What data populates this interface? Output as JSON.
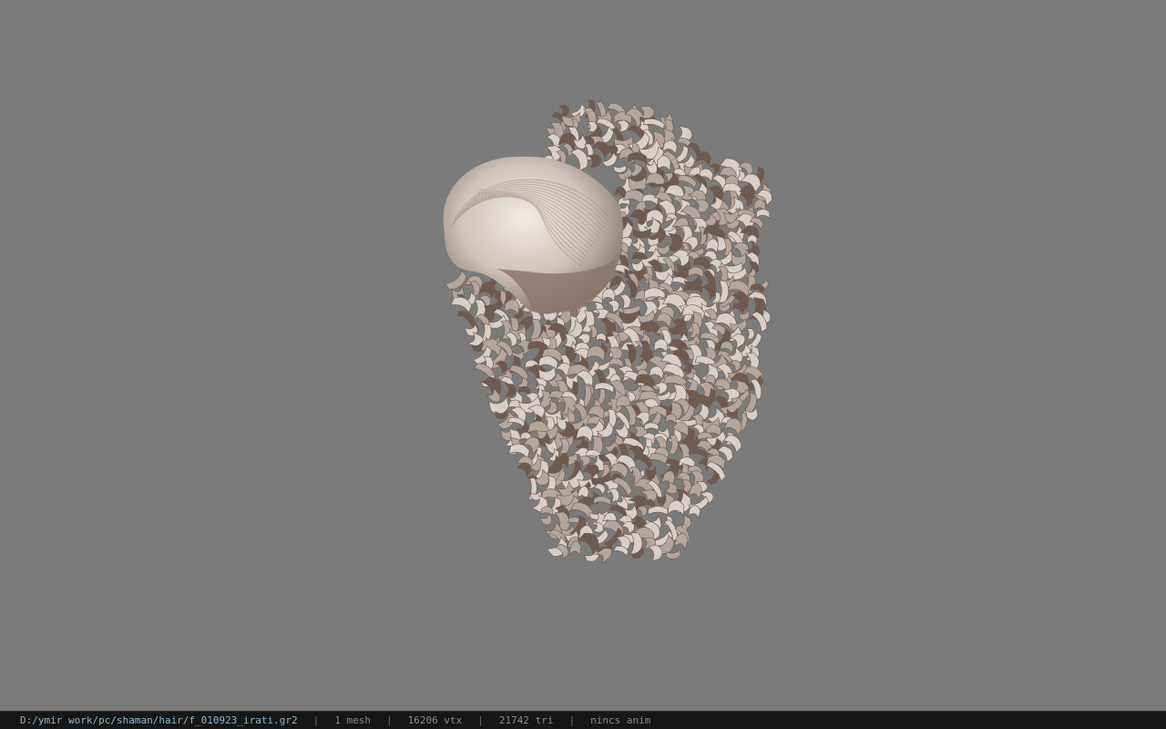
{
  "viewer": {
    "background_color": "#7b7b7b",
    "model_name": "hair mesh",
    "hair_light": "#d9cfc8",
    "hair_mid": "#b4a69c",
    "hair_dark": "#6f5a50"
  },
  "status_bar": {
    "file_path": "D:/ymir work/pc/shaman/hair/f_010923_irati.gr2",
    "separator": "|",
    "mesh_count": "1 mesh",
    "vertex_count": "16206 vtx",
    "triangle_count": "21742 tri",
    "anim_status": "nincs anim"
  }
}
